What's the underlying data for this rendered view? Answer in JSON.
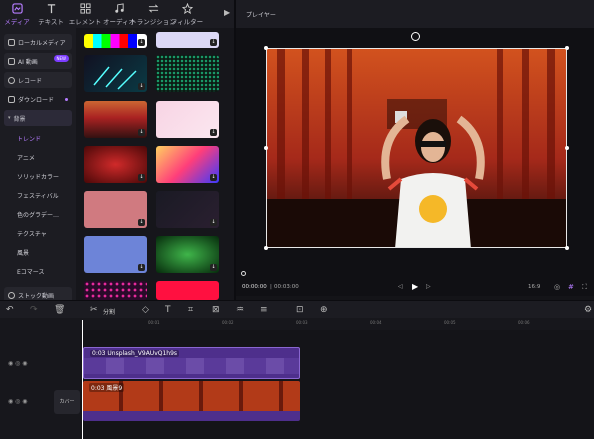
{
  "media_tabs": [
    {
      "label": "メディア",
      "icon": "media-icon",
      "active": true
    },
    {
      "label": "テキスト",
      "icon": "text-icon",
      "active": false
    },
    {
      "label": "エレメント",
      "icon": "element-icon",
      "active": false
    },
    {
      "label": "オーディオ",
      "icon": "audio-icon",
      "active": false
    },
    {
      "label": "トランジション",
      "icon": "transition-icon",
      "active": false
    },
    {
      "label": "フィルター",
      "icon": "filter-icon",
      "active": false
    }
  ],
  "sidebar": {
    "items": [
      {
        "label": "ローカルメディア",
        "style": "box"
      },
      {
        "label": "AI 動画",
        "style": "box",
        "badge": "NEW"
      },
      {
        "label": "レコード",
        "style": "box"
      },
      {
        "label": "ダウンロード",
        "style": "plain",
        "dot": true
      },
      {
        "label": "背景",
        "style": "selected"
      }
    ],
    "sub_items": [
      "トレンド",
      "アニメ",
      "ソリッドカラー",
      "フェスティバル",
      "色のグラデー…",
      "テクスチャ",
      "風景",
      "Eコマース"
    ],
    "bottom_item": "ストック動画"
  },
  "player": {
    "title": "プレイヤー",
    "time_current": "00:00:00",
    "time_total": "00:03:00",
    "aspect_ratio": "16:9"
  },
  "timeline": {
    "split_label": "分割",
    "ruler_ticks": [
      "00:00",
      "00:01",
      "00:02",
      "00:03",
      "00:04",
      "00:05",
      "00:06",
      "00:07"
    ],
    "clip1_label": "0:03 Unsplash_V9AUvQ1h9s",
    "clip2_label": "0:03 風景9",
    "cover_label": "カバー"
  },
  "colors": {
    "accent": "#b57cff",
    "clip": "#4e2f8c"
  }
}
